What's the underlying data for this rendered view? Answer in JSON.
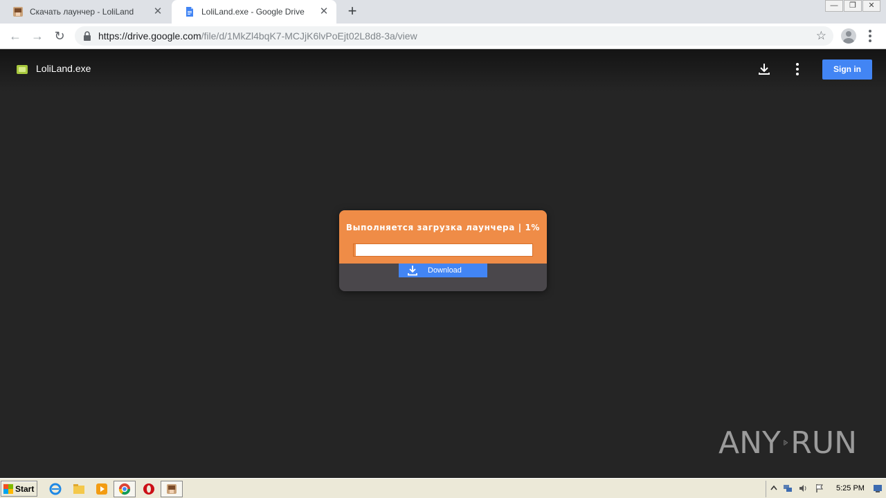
{
  "browser": {
    "tabs": [
      {
        "title": "Скачать лаунчер - LoliLand",
        "active": false,
        "favicon": "loliland-favicon"
      },
      {
        "title": "LoliLand.exe - Google Drive",
        "active": true,
        "favicon": "google-docs-favicon"
      }
    ],
    "close_glyph": "✕",
    "new_tab_glyph": "+",
    "url_host": "https://drive.google.com",
    "url_path": "/file/d/1MkZl4bqK7-MCJjK6lvPoEjt02L8d8-3a/view"
  },
  "viewer": {
    "filename": "LoliLand.exe",
    "signin_label": "Sign in",
    "icons": [
      "file-type-icon",
      "download-icon",
      "more-options-icon"
    ]
  },
  "modal": {
    "title": "Выполняется загрузка лаунчера | 1%",
    "progress_fraction": 0.01,
    "download_label": "Download",
    "colors": {
      "header": "#ef8c47",
      "body": "#4a474b",
      "button": "#4285f4"
    }
  },
  "watermark": {
    "left_text": "ANY",
    "right_text": "RUN"
  },
  "taskbar": {
    "start_label": "Start",
    "clock": "5:25 PM"
  }
}
